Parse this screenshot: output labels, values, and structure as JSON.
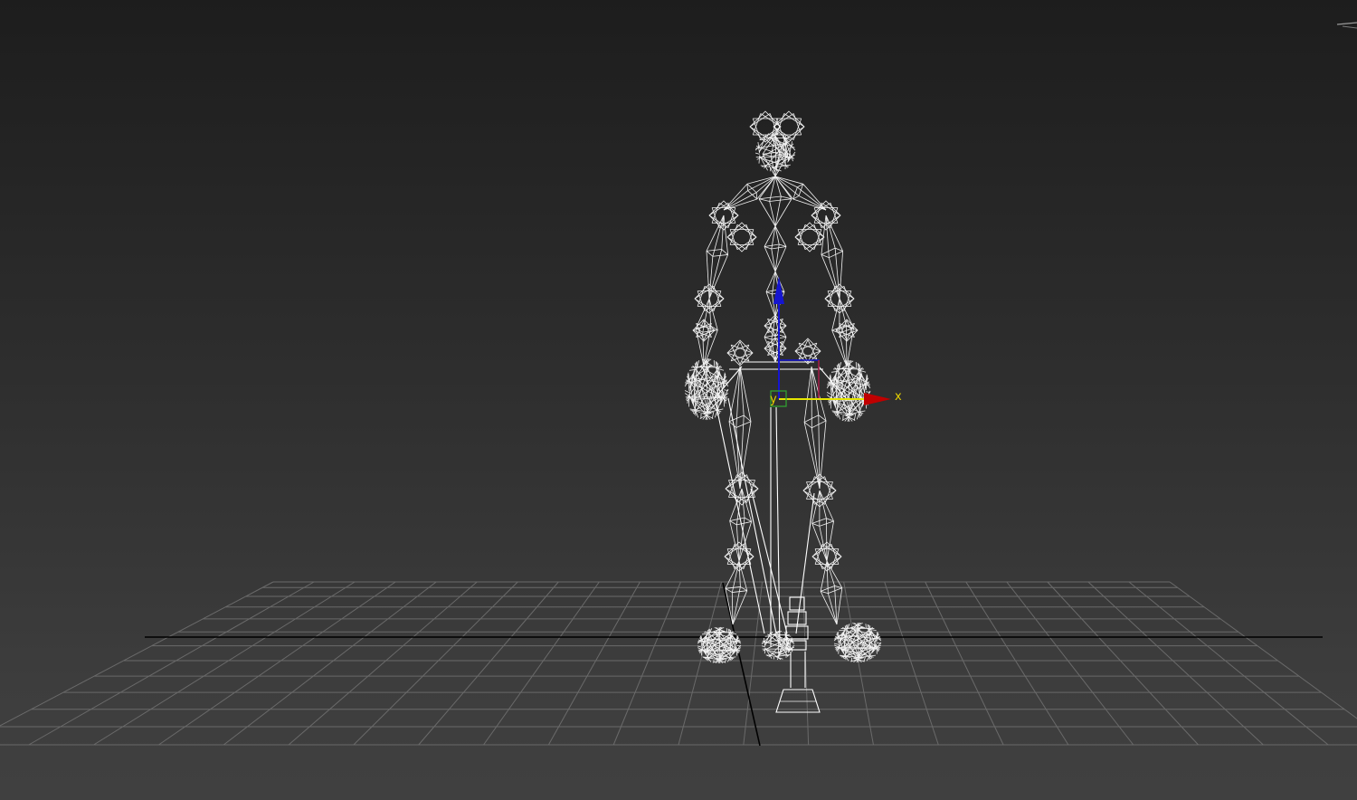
{
  "viewport": {
    "gizmo": {
      "x_label": "x",
      "y_label": "y",
      "colors": {
        "x": "#d40000",
        "y": "#e6e600",
        "z": "#1515d0",
        "label": "#e6d000"
      }
    },
    "grid": {
      "color": "#6a6a6a",
      "home_axis_color": "#000000"
    },
    "background": {
      "top": "#1d1d1d",
      "bottom": "#404040"
    },
    "wireframe_color": "#ffffff",
    "corner_icon": "axis-tripod-icon"
  }
}
